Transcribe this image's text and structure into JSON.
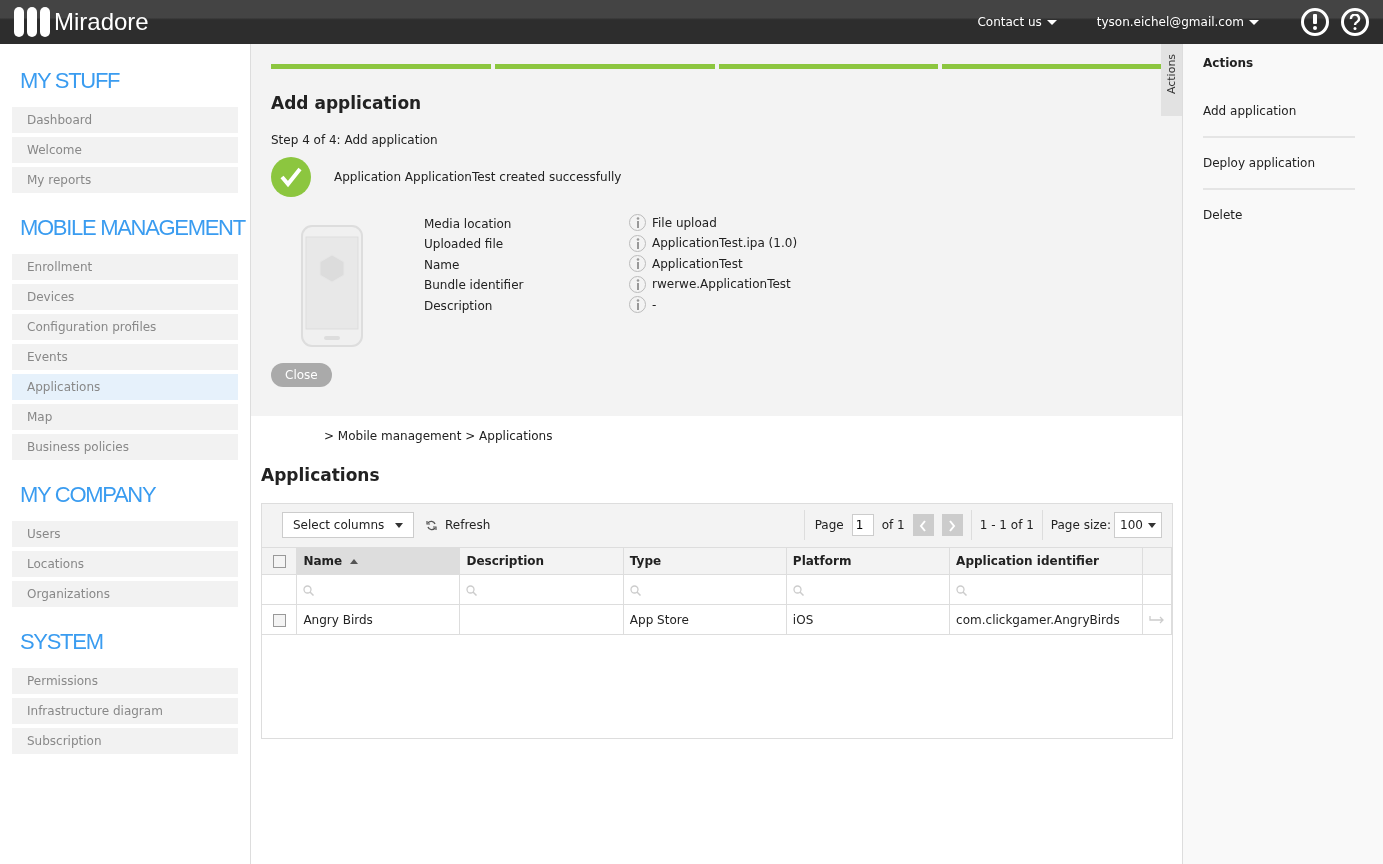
{
  "header": {
    "logo": "Miradore",
    "contact": "Contact us",
    "user": "tyson.eichel@gmail.com"
  },
  "sidebar": {
    "sections": [
      {
        "title": "MY STUFF",
        "items": [
          {
            "label": "Dashboard",
            "selected": false
          },
          {
            "label": "Welcome",
            "selected": false
          },
          {
            "label": "My reports",
            "selected": false
          }
        ]
      },
      {
        "title": "MOBILE MANAGEMENT",
        "items": [
          {
            "label": "Enrollment",
            "selected": false
          },
          {
            "label": "Devices",
            "selected": false
          },
          {
            "label": "Configuration profiles",
            "selected": false
          },
          {
            "label": "Events",
            "selected": false
          },
          {
            "label": "Applications",
            "selected": true
          },
          {
            "label": "Map",
            "selected": false
          },
          {
            "label": "Business policies",
            "selected": false
          }
        ]
      },
      {
        "title": "MY COMPANY",
        "items": [
          {
            "label": "Users",
            "selected": false
          },
          {
            "label": "Locations",
            "selected": false
          },
          {
            "label": "Organizations",
            "selected": false
          }
        ]
      },
      {
        "title": "SYSTEM",
        "items": [
          {
            "label": "Permissions",
            "selected": false
          },
          {
            "label": "Infrastructure diagram",
            "selected": false
          },
          {
            "label": "Subscription",
            "selected": false
          }
        ]
      }
    ]
  },
  "wizard": {
    "steps": [
      {
        "done": true
      },
      {
        "done": true
      },
      {
        "done": true
      },
      {
        "done": true
      }
    ],
    "title": "Add application",
    "step_text": "Step 4 of 4: Add application",
    "message": "Application ApplicationTest created successfully",
    "details": [
      {
        "label": "Media location",
        "value": "File upload"
      },
      {
        "label": "Uploaded file",
        "value": "ApplicationTest.ipa (1.0)"
      },
      {
        "label": "Name",
        "value": "ApplicationTest"
      },
      {
        "label": "Bundle identifier",
        "value": "rwerwe.ApplicationTest"
      },
      {
        "label": "Description",
        "value": "-"
      }
    ],
    "close_button": "Close",
    "actions_tab": "Actions"
  },
  "breadcrumb": "> Mobile management > Applications",
  "page_title": "Applications",
  "toolbar": {
    "select_columns": "Select columns",
    "refresh": "Refresh",
    "page_label": "Page",
    "page_value": "1",
    "page_of": "of 1",
    "range": "1 - 1 of 1",
    "page_size_label": "Page size:",
    "page_size": "100"
  },
  "table": {
    "select_all_checked": false,
    "columns": [
      {
        "label": "Name",
        "sorted": true
      },
      {
        "label": "Description",
        "sorted": false
      },
      {
        "label": "Type",
        "sorted": false
      },
      {
        "label": "Platform",
        "sorted": false
      },
      {
        "label": "Application identifier",
        "sorted": false
      }
    ],
    "rows": [
      {
        "checked": false,
        "cells": [
          "Angry Birds",
          "",
          "App Store",
          "iOS",
          "com.clickgamer.AngryBirds"
        ]
      }
    ]
  },
  "actions_panel": {
    "title": "Actions",
    "items": [
      "Add application",
      "Deploy application",
      "Delete"
    ]
  }
}
